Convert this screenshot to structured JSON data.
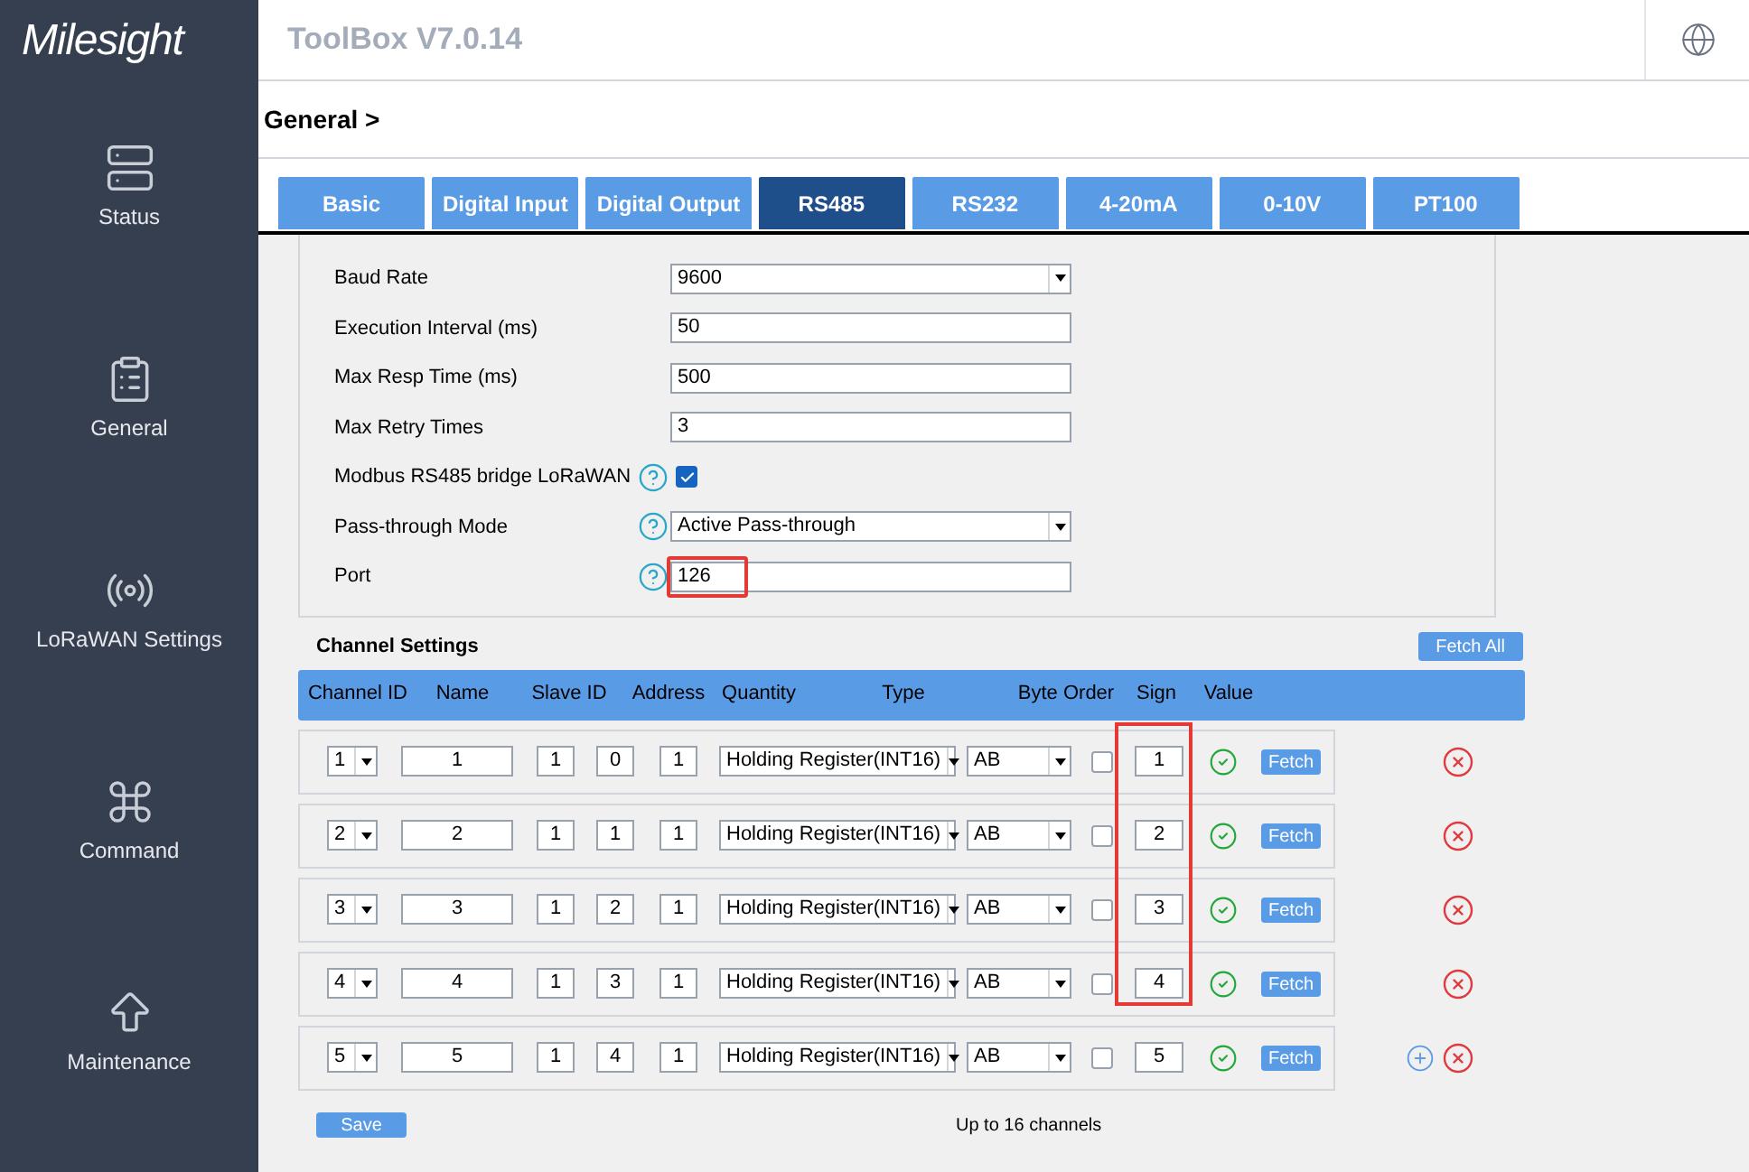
{
  "brand": {
    "logo": "Milesight"
  },
  "header": {
    "title": "ToolBox V7.0.14"
  },
  "sidebar": {
    "items": [
      {
        "label": "Status"
      },
      {
        "label": "General"
      },
      {
        "label": "LoRaWAN Settings"
      },
      {
        "label": "Command"
      },
      {
        "label": "Maintenance"
      }
    ]
  },
  "breadcrumb": "General >",
  "tabs": [
    {
      "label": "Basic",
      "selected": false
    },
    {
      "label": "Digital Input",
      "selected": false
    },
    {
      "label": "Digital Output",
      "selected": false
    },
    {
      "label": "RS485",
      "selected": true
    },
    {
      "label": "RS232",
      "selected": false
    },
    {
      "label": "4-20mA",
      "selected": false
    },
    {
      "label": "0-10V",
      "selected": false
    },
    {
      "label": "PT100",
      "selected": false
    }
  ],
  "form": [
    {
      "kind": "select",
      "label": "Baud Rate",
      "value": "9600",
      "help": false,
      "highlighted": false
    },
    {
      "kind": "text",
      "label": "Execution Interval (ms)",
      "value": "50",
      "help": false,
      "highlighted": false
    },
    {
      "kind": "text",
      "label": "Max Resp Time (ms)",
      "value": "500",
      "help": false,
      "highlighted": false
    },
    {
      "kind": "text",
      "label": "Max Retry Times",
      "value": "3",
      "help": false,
      "highlighted": false
    },
    {
      "kind": "checkbox",
      "label": "Modbus RS485 bridge LoRaWAN",
      "checked": true,
      "help": true,
      "highlighted": false
    },
    {
      "kind": "select",
      "label": "Pass-through Mode",
      "value": "Active Pass-through",
      "help": true,
      "highlighted": false
    },
    {
      "kind": "text",
      "label": "Port",
      "value": "126",
      "help": true,
      "highlighted": true
    }
  ],
  "channels": {
    "title": "Channel Settings",
    "fetch_all": "Fetch All",
    "columns": [
      "Channel ID",
      "Name",
      "Slave ID",
      "Address",
      "Quantity",
      "Type",
      "Byte Order",
      "Sign",
      "Value"
    ],
    "rows": [
      {
        "channel_id": "1",
        "name": "1",
        "slave_id": "1",
        "address": "0",
        "quantity": "1",
        "type": "Holding Register(INT16)",
        "byte_order": "AB",
        "sign": false,
        "value": "1",
        "fetch": "Fetch",
        "can_add": false
      },
      {
        "channel_id": "2",
        "name": "2",
        "slave_id": "1",
        "address": "1",
        "quantity": "1",
        "type": "Holding Register(INT16)",
        "byte_order": "AB",
        "sign": false,
        "value": "2",
        "fetch": "Fetch",
        "can_add": false
      },
      {
        "channel_id": "3",
        "name": "3",
        "slave_id": "1",
        "address": "2",
        "quantity": "1",
        "type": "Holding Register(INT16)",
        "byte_order": "AB",
        "sign": false,
        "value": "3",
        "fetch": "Fetch",
        "can_add": false
      },
      {
        "channel_id": "4",
        "name": "4",
        "slave_id": "1",
        "address": "3",
        "quantity": "1",
        "type": "Holding Register(INT16)",
        "byte_order": "AB",
        "sign": false,
        "value": "4",
        "fetch": "Fetch",
        "can_add": false
      },
      {
        "channel_id": "5",
        "name": "5",
        "slave_id": "1",
        "address": "4",
        "quantity": "1",
        "type": "Holding Register(INT16)",
        "byte_order": "AB",
        "sign": false,
        "value": "5",
        "fetch": "Fetch",
        "can_add": true
      }
    ],
    "highlight_values": true,
    "save": "Save",
    "note": "Up to 16 channels"
  }
}
